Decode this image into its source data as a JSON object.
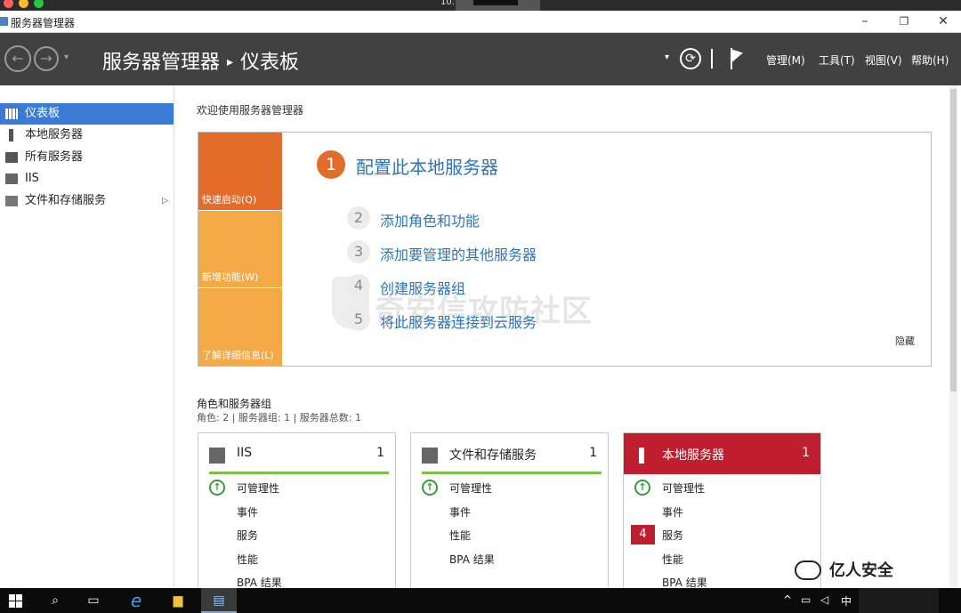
{
  "window": {
    "title": "服务器管理器",
    "mac_title": "10."
  },
  "window_controls": {
    "minimize": "–",
    "restore": "❐",
    "close": "✕"
  },
  "header": {
    "back_label": "←",
    "forward_label": "→",
    "dropdown": "▾",
    "breadcrumb_root": "服务器管理器",
    "breadcrumb_sep": "▸",
    "breadcrumb_page": "仪表板",
    "refresh_dd": "▾",
    "refresh": "⟳",
    "menus": [
      "管理(M)",
      "工具(T)",
      "视图(V)",
      "帮助(H)"
    ]
  },
  "sidebar": {
    "items": [
      {
        "label": "仪表板",
        "icon": "dashboard-icon"
      },
      {
        "label": "本地服务器",
        "icon": "server-icon"
      },
      {
        "label": "所有服务器",
        "icon": "servers-icon"
      },
      {
        "label": "IIS",
        "icon": "iis-icon"
      },
      {
        "label": "文件和存储服务",
        "icon": "storage-icon"
      }
    ],
    "expand_arrow": "▷"
  },
  "main": {
    "welcome": "欢迎使用服务器管理器",
    "quick_tabs": [
      "快速启动(Q)",
      "新增功能(W)",
      "了解详细信息(L)"
    ],
    "steps": [
      {
        "num": "1",
        "label": "配置此本地服务器"
      },
      {
        "num": "2",
        "label": "添加角色和功能"
      },
      {
        "num": "3",
        "label": "添加要管理的其他服务器"
      },
      {
        "num": "4",
        "label": "创建服务器组"
      },
      {
        "num": "5",
        "label": "将此服务器连接到云服务"
      }
    ],
    "hide": "隐藏",
    "watermark": "奇安信攻防社区",
    "roles_title": "角色和服务器组",
    "roles_sub": "角色: 2 | 服务器组: 1 | 服务器总数: 1",
    "tiles": [
      {
        "name": "IIS",
        "count": "1",
        "rows": [
          "可管理性",
          "事件",
          "服务",
          "性能",
          "BPA 结果"
        ]
      },
      {
        "name": "文件和存储服务",
        "count": "1",
        "rows": [
          "可管理性",
          "事件",
          "性能",
          "BPA 结果"
        ]
      },
      {
        "name": "本地服务器",
        "count": "1",
        "rows": [
          "可管理性",
          "事件",
          "服务",
          "性能",
          "BPA 结果"
        ],
        "badge": "4"
      }
    ],
    "ok_symbol": "↑"
  },
  "brand_watermark": "亿人安全",
  "taskbar": {
    "search": "⌕",
    "taskview": "▭",
    "ie": "e",
    "explorer": "▆",
    "server_manager": "▤",
    "tray_up": "^",
    "tray_net": "▭",
    "tray_vol": "◁",
    "ime": "中"
  },
  "colors": {
    "accent_orange": "#e46c2b",
    "accent_amber": "#f4a947",
    "link_blue": "#2e75b6",
    "alert_red": "#be1e2d",
    "ok_green": "#7cc144",
    "header_bg": "#414141"
  }
}
